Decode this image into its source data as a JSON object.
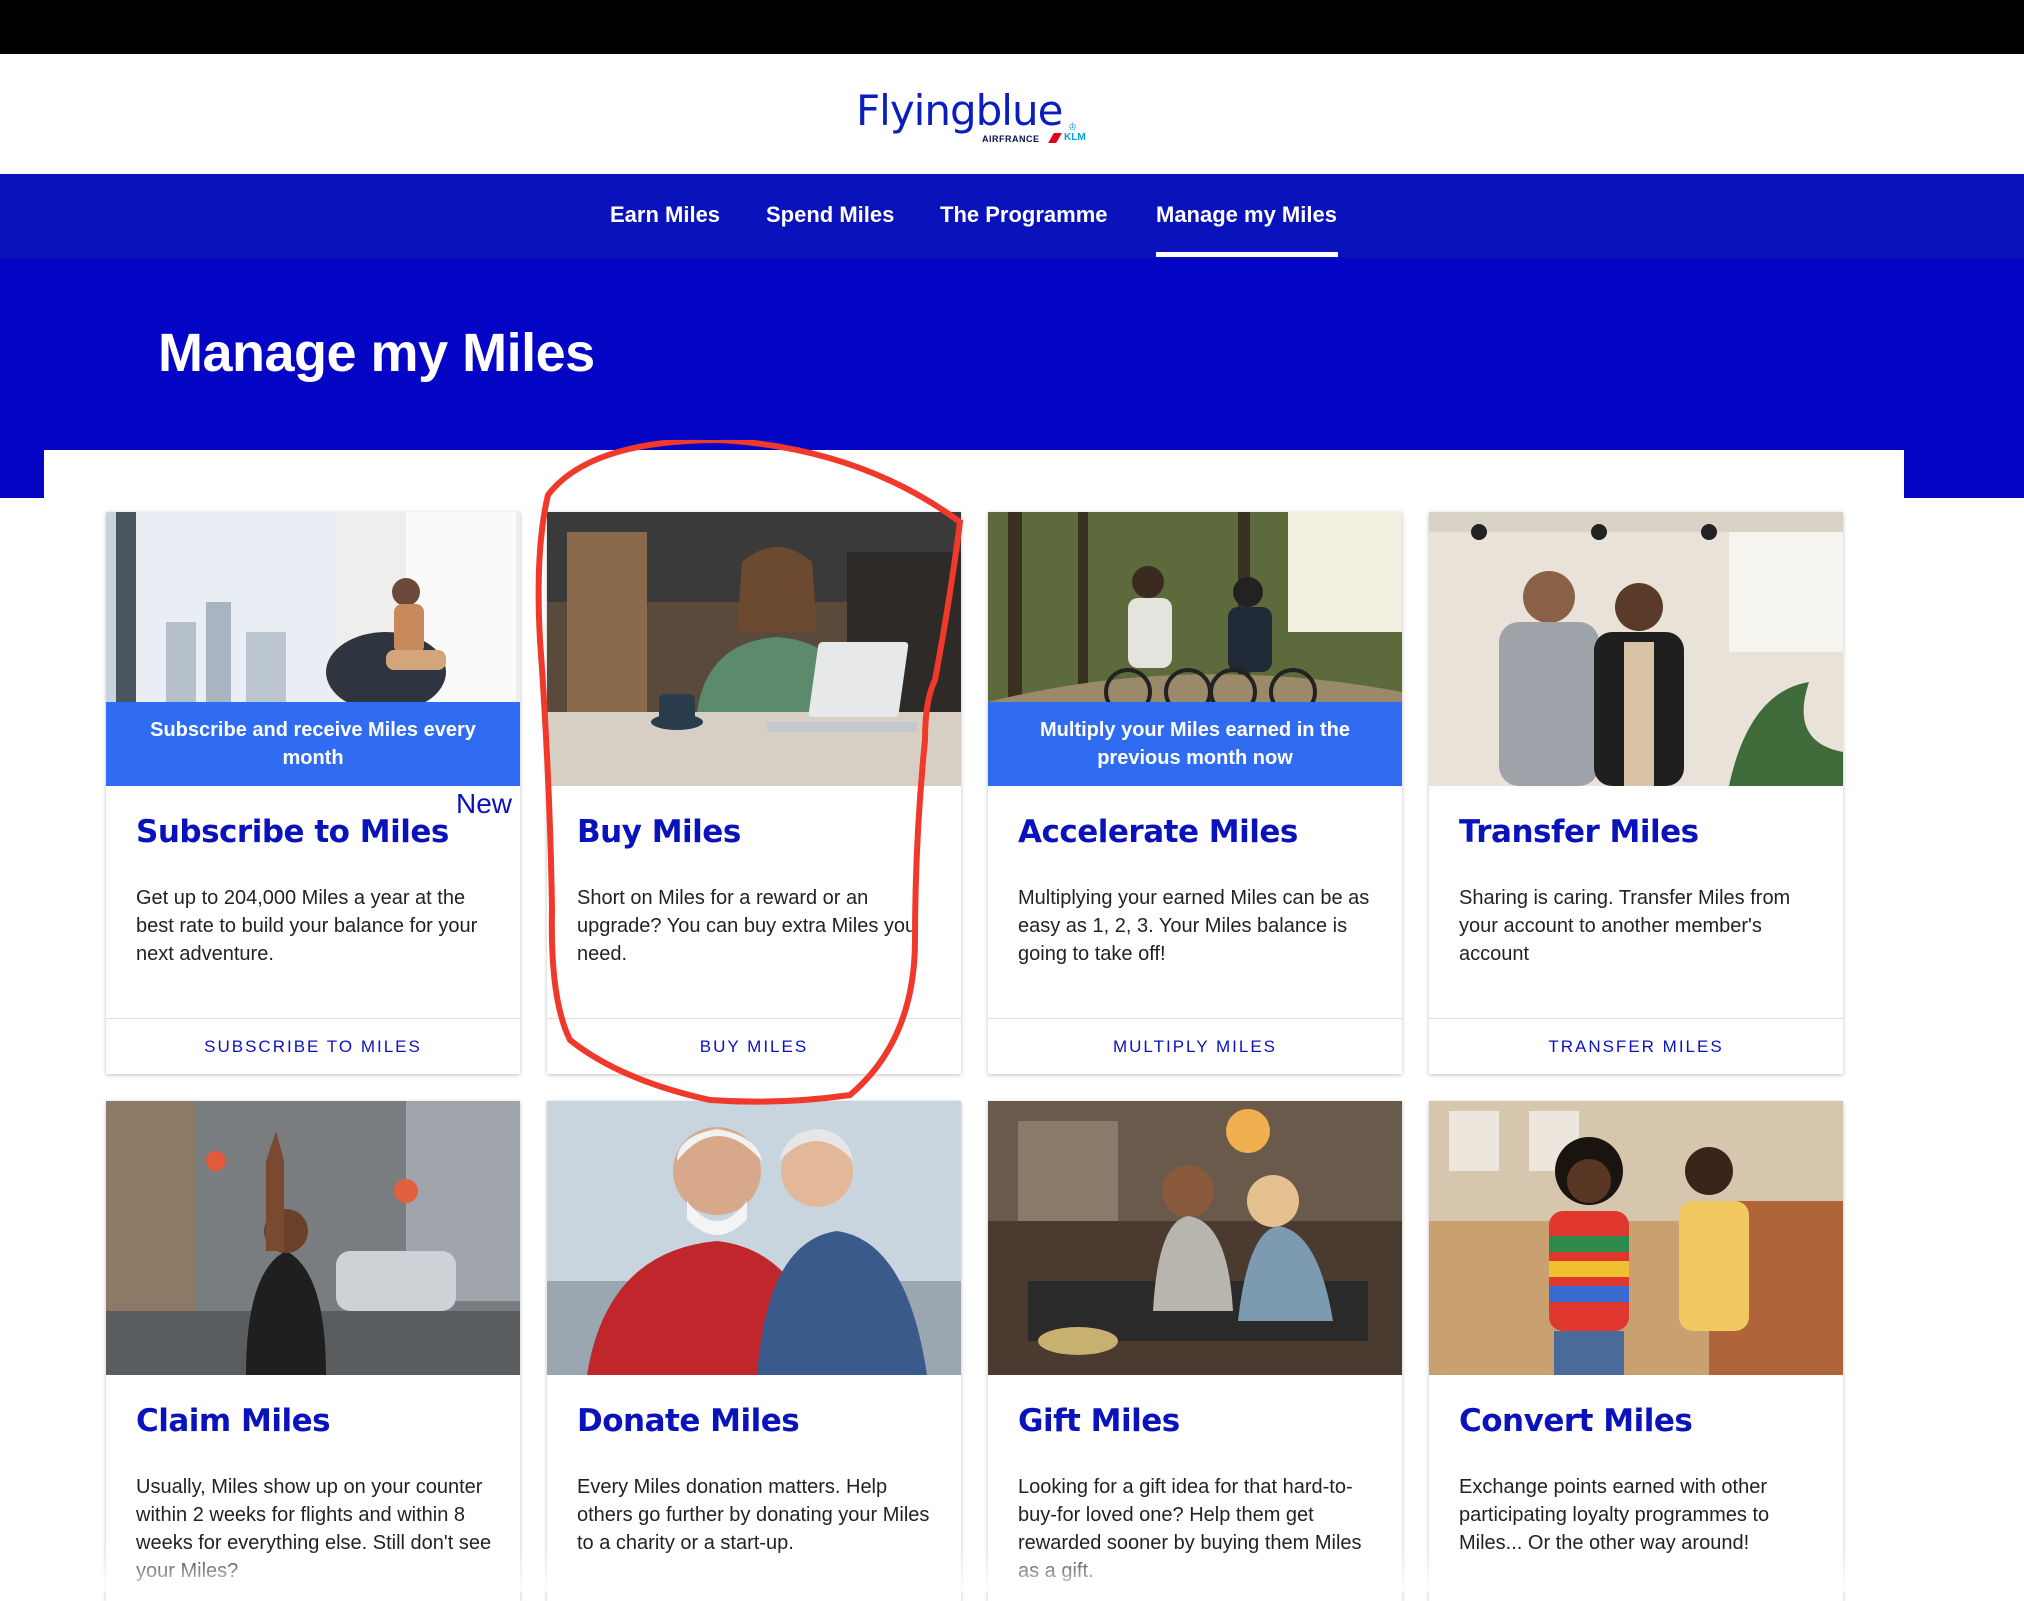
{
  "logo": {
    "name": "Flyingblue",
    "airline1": "AIRFRANCE",
    "airline2": "KLM"
  },
  "nav": {
    "items": [
      {
        "label": "Earn Miles"
      },
      {
        "label": "Spend Miles"
      },
      {
        "label": "The Programme"
      },
      {
        "label": "Manage my Miles",
        "active": true
      }
    ]
  },
  "hero": {
    "title": "Manage my Miles"
  },
  "cards": [
    {
      "title": "Subscribe to Miles",
      "banner": "Subscribe and receive Miles every month",
      "badge": "New",
      "text": "Get up to 204,000 Miles a year at the best rate to build your balance for your next adventure.",
      "button": "SUBSCRIBE TO MILES"
    },
    {
      "title": "Buy Miles",
      "text": "Short on Miles for a reward or an upgrade? You can buy extra Miles you need.",
      "button": "BUY MILES"
    },
    {
      "title": "Accelerate Miles",
      "banner": "Multiply your Miles earned in the previous month now",
      "text": "Multiplying your earned Miles can be as easy as 1, 2, 3. Your Miles balance is going to take off!",
      "button": "MULTIPLY MILES"
    },
    {
      "title": "Transfer Miles",
      "text": "Sharing is caring. Transfer Miles from your account to another member's account",
      "button": "TRANSFER MILES"
    },
    {
      "title": "Claim Miles",
      "text": "Usually, Miles show up on your counter within 2 weeks for flights and within 8 weeks for everything else. Still don't see your Miles?"
    },
    {
      "title": "Donate Miles",
      "text": "Every Miles donation matters. Help others go further by donating your Miles to a charity or a start-up."
    },
    {
      "title": "Gift Miles",
      "text": "Looking for a gift idea for that hard-to-buy-for loved one? Help them get rewarded sooner by buying them Miles as a gift."
    },
    {
      "title": "Convert Miles",
      "text": "Exchange points earned with other participating loyalty programmes to Miles... Or the other way around!"
    }
  ],
  "colors": {
    "brand": "#0a13bb",
    "hero": "#0505c5",
    "banner": "#2f6cf2",
    "annotation": "#f0392b"
  }
}
